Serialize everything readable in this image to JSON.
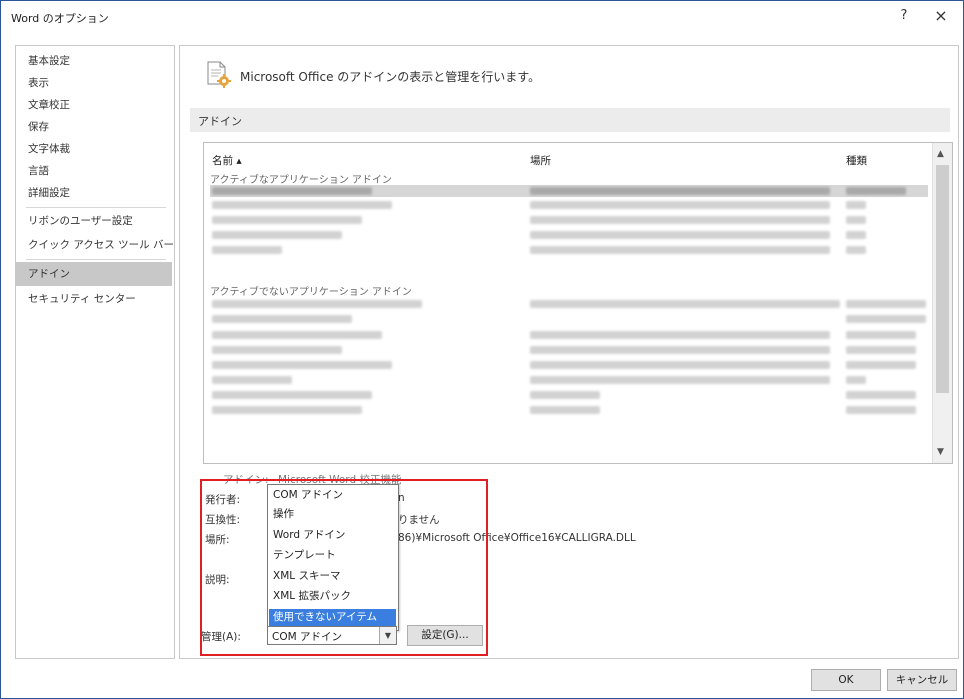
{
  "window": {
    "title": "Word のオプション",
    "help": "?",
    "close": "×"
  },
  "nav": {
    "items": [
      "基本設定",
      "表示",
      "文章校正",
      "保存",
      "文字体裁",
      "言語",
      "詳細設定",
      "リボンのユーザー設定",
      "クイック アクセス ツール バー",
      "アドイン",
      "セキュリティ センター"
    ],
    "selected_index": 9
  },
  "header": {
    "text": "Microsoft Office のアドインの表示と管理を行います。"
  },
  "section": {
    "title": "アドイン"
  },
  "addin_list": {
    "columns": [
      "名前 ▴",
      "場所",
      "種類"
    ],
    "active_group": "アクティブなアプリケーション アドイン",
    "inactive_group": "アクティブでないアプリケーション アドイン"
  },
  "details": {
    "addin_label": "アドイン:",
    "addin_value": "Microsoft Word 校正機能",
    "publisher_label": "発行者:",
    "publisher_suffix": "n",
    "compat_label": "互換性:",
    "compat_suffix": "りません",
    "location_label": "場所:",
    "location_suffix": "86)¥Microsoft Office¥Office16¥CALLIGRA.DLL",
    "desc_label": "説明:"
  },
  "manage_dropdown": {
    "options": [
      "COM アドイン",
      "操作",
      "Word アドイン",
      "テンプレート",
      "XML スキーマ",
      "XML 拡張パック",
      "使用できないアイテム"
    ],
    "highlighted_index": 6
  },
  "manage": {
    "label": "管理(A):",
    "selected": "COM アドイン",
    "settings_button": "設定(G)..."
  },
  "buttons": {
    "ok": "OK",
    "cancel": "キャンセル"
  },
  "colors": {
    "highlight": "#3a7fe0",
    "annotation": "#e02020",
    "window_border": "#2b579a"
  }
}
